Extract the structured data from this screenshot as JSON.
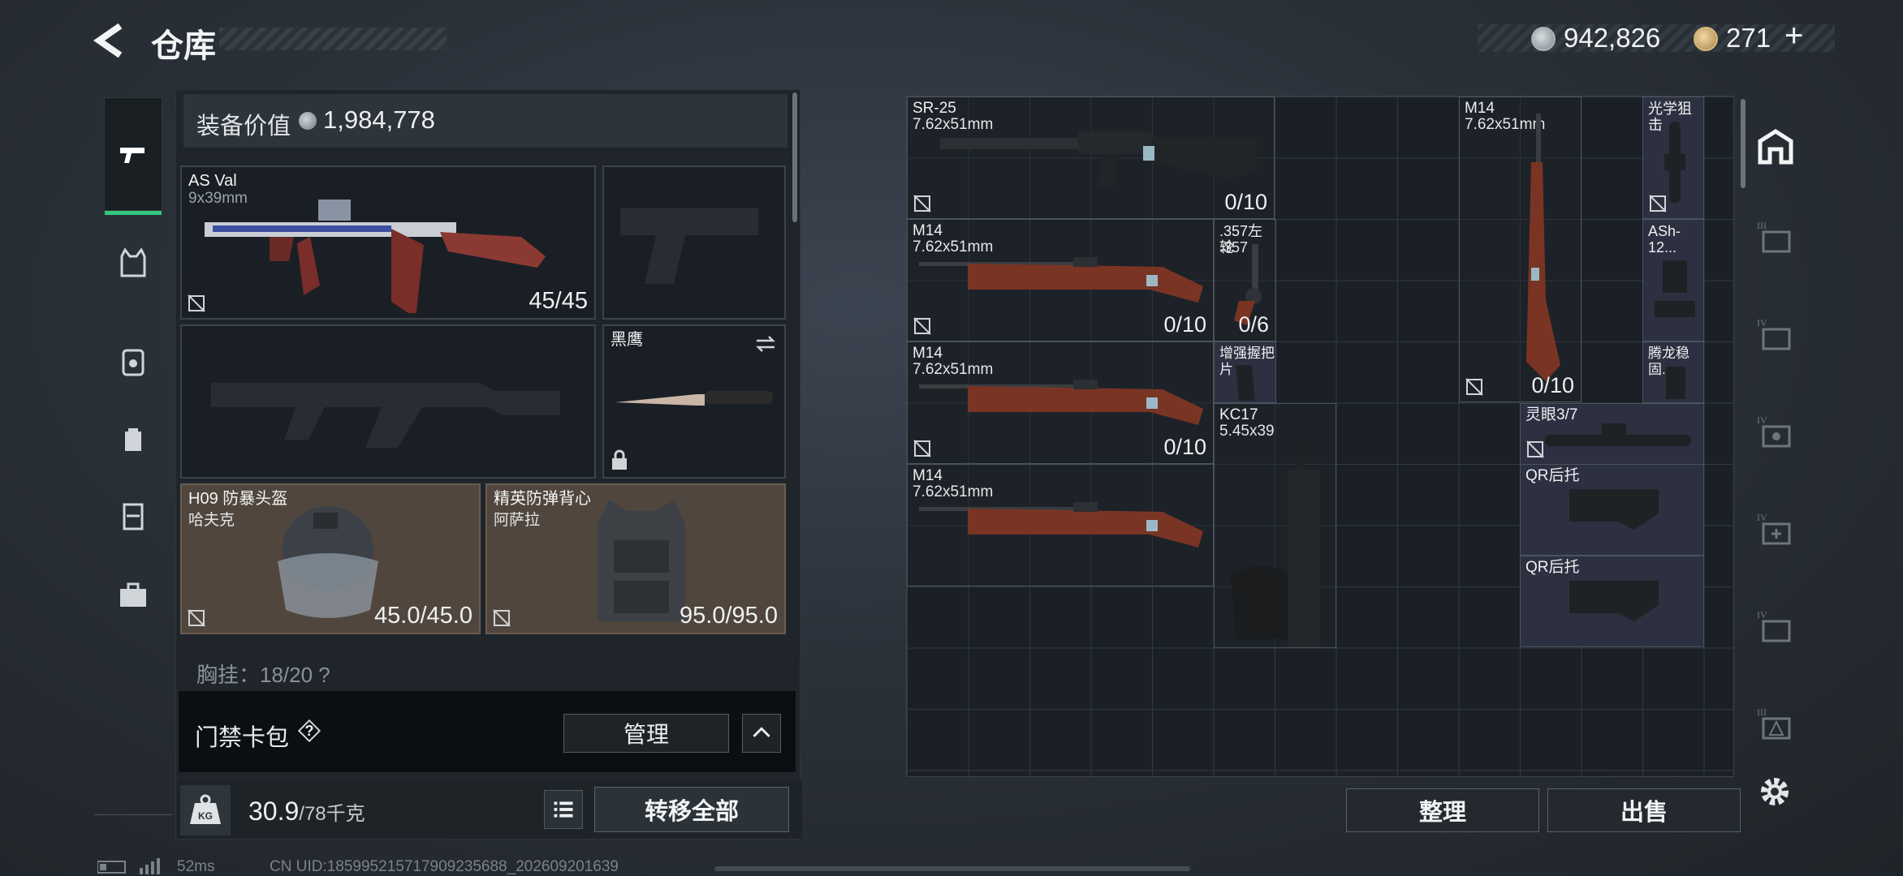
{
  "header": {
    "title": "仓库",
    "money": "942,826",
    "tickets": "271",
    "plus": "+"
  },
  "rail": {
    "items": [
      "pistol-icon",
      "vest-icon",
      "rig-icon",
      "backpack-icon",
      "container-icon",
      "toolbox-icon"
    ]
  },
  "loadout": {
    "value_label": "装备价值",
    "value_amount": "1,984,778",
    "primary": {
      "name": "AS Val",
      "caliber": "9x39mm",
      "count": "45/45"
    },
    "melee": {
      "name": "黑鹰"
    },
    "helmet": {
      "name": "H09 防暴头盔",
      "sub": "哈夫克",
      "durability": "45.0/45.0"
    },
    "armor": {
      "name": "精英防弹背心",
      "sub": "阿萨拉",
      "durability": "95.0/95.0"
    },
    "chest_partial": "胸挂：18/20 ?"
  },
  "keycard": {
    "label": "门禁卡包",
    "help": "?",
    "manage": "管理"
  },
  "weight": {
    "value": "30.9",
    "max": "/78千克",
    "transfer": "转移全部"
  },
  "stash": {
    "items": [
      {
        "name": "SR-25",
        "sub": "7.62x51mm",
        "count": "0/10"
      },
      {
        "name": "M14",
        "sub": "7.62x51mm",
        "count": "0/10"
      },
      {
        "name": "光学狙击",
        "sub": "",
        "count": ""
      },
      {
        "name": "M14",
        "sub": "7.62x51mm",
        "count": "0/10"
      },
      {
        "name": ".357左轮",
        "sub": ".357",
        "count": "0/6"
      },
      {
        "name": "ASh-12...",
        "sub": "",
        "count": ""
      },
      {
        "name": "M14",
        "sub": "7.62x51mm",
        "count": "0/10"
      },
      {
        "name": "增强握把片",
        "sub": "",
        "count": ""
      },
      {
        "name": "腾龙稳固...",
        "sub": "",
        "count": ""
      },
      {
        "name": "KC17",
        "sub": "5.45x39",
        "count": ""
      },
      {
        "name": "灵眼3/7",
        "sub": "",
        "count": ""
      },
      {
        "name": "M14",
        "sub": "7.62x51mm",
        "count": ""
      },
      {
        "name": "QR后托",
        "sub": "",
        "count": ""
      },
      {
        "name": "QR后托",
        "sub": "",
        "count": ""
      }
    ],
    "sort": "整理",
    "sell": "出售"
  },
  "right_rail": {
    "levels": [
      "III",
      "IV",
      "IV",
      "IV",
      "IV",
      "III"
    ]
  },
  "footer": {
    "ping": "52ms",
    "uid": "CN UID:185995215717909235688_202609201639"
  },
  "colors": {
    "accent": "#34c77b",
    "armor_bg": "#51463d",
    "mod_bg": "#2c3040"
  }
}
